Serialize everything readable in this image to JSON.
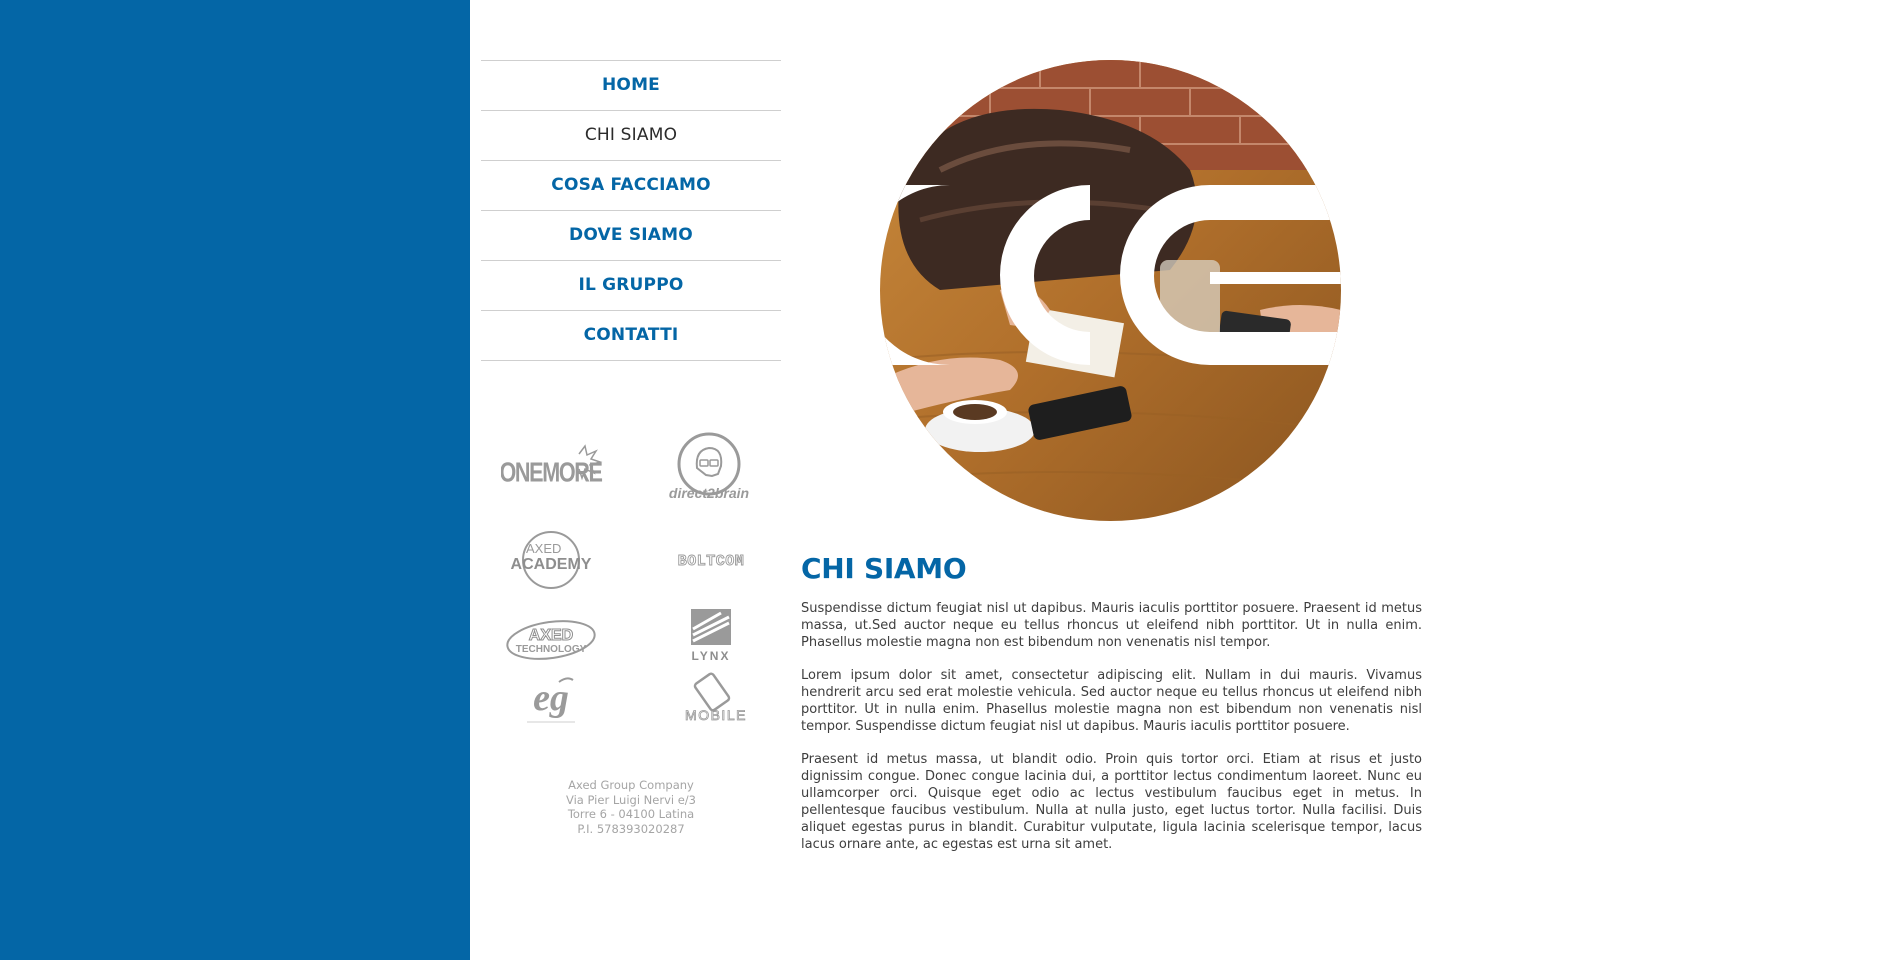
{
  "nav": {
    "items": [
      {
        "label": "HOME",
        "active": false
      },
      {
        "label": "CHI SIAMO",
        "active": true
      },
      {
        "label": "COSA FACCIAMO",
        "active": false
      },
      {
        "label": "DOVE SIAMO",
        "active": false
      },
      {
        "label": "IL GRUPPO",
        "active": false
      },
      {
        "label": "CONTATTI",
        "active": false
      }
    ]
  },
  "logos": {
    "onemore": "ONEMORE",
    "direct2brain": "direct2brain",
    "axed_academy_top": "AXED",
    "axed_academy_bottom": "ACADEMY",
    "boltcom": "BOLTCOM",
    "axed_technology_top": "AXED",
    "axed_technology_bottom": "TECHNOLOGY",
    "lynx": "LYNX",
    "eg": "eg",
    "mobile": "MOBILE"
  },
  "address": {
    "line1": "Axed Group Company",
    "line2": "Via Pier Luigi Nervi e/3",
    "line3": "Torre 6 - 04100 Latina",
    "line4": "P.I. 578393020287"
  },
  "hero": {
    "logo_icon": "axed-logo-icon"
  },
  "main": {
    "heading": "CHI SIAMO",
    "paragraphs": [
      "Suspendisse dictum feugiat nisl ut dapibus. Mauris iaculis porttitor posuere. Praesent id metus massa, ut.Sed auctor neque eu tellus rhoncus ut eleifend nibh porttitor. Ut in nulla enim. Phasellus molestie magna non est bibendum non venenatis nisl tempor.",
      "Lorem ipsum dolor sit amet, consectetur adipiscing elit. Nullam in dui mauris. Vivamus hendrerit arcu sed erat molestie vehicula. Sed auctor neque eu tellus rhoncus ut eleifend nibh porttitor. Ut in nulla enim. Phasellus molestie magna non est bibendum non venenatis nisl tempor. Suspendisse dictum feugiat nisl ut dapibus. Mauris iaculis porttitor posuere.",
      "Praesent id metus massa, ut blandit odio. Proin quis tortor orci. Etiam at risus et justo dignissim congue. Donec congue lacinia dui, a porttitor lectus condimentum laoreet. Nunc eu ullamcorper orci. Quisque eget odio ac lectus vestibulum faucibus eget in metus. In pellentesque faucibus vestibulum. Nulla at nulla justo, eget luctus tortor. Nulla facilisi. Duis aliquet egestas purus in blandit. Curabitur vulputate, ligula lacinia scelerisque tempor, lacus lacus ornare ante, ac egestas est urna sit amet."
    ]
  },
  "colors": {
    "brand_blue": "#0466a6",
    "text": "#3e3e3e",
    "muted": "#a5a5a5"
  }
}
